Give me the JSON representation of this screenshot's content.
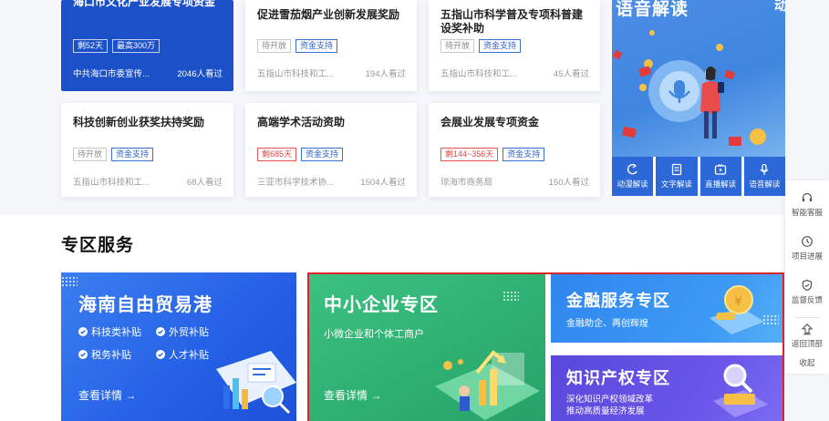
{
  "policy_cards": [
    {
      "title": "海口市文化产业发展专项资金",
      "tags": [
        {
          "text": "剩52天",
          "style": "white"
        },
        {
          "text": "最高300万",
          "style": "white"
        }
      ],
      "source": "中共海口市委宣传...",
      "views": "2046人看过",
      "highlighted": true
    },
    {
      "title": "促进雪茄烟产业创新发展奖励",
      "tags": [
        {
          "text": "待开放",
          "style": "gray"
        },
        {
          "text": "资金支持",
          "style": "blue"
        }
      ],
      "source": "五指山市科技和工...",
      "views": "194人看过"
    },
    {
      "title": "五指山市科学普及专项科普建设奖补助",
      "tags": [
        {
          "text": "待开放",
          "style": "gray"
        },
        {
          "text": "资金支持",
          "style": "blue"
        }
      ],
      "source": "五指山市科技和工...",
      "views": "45人看过"
    },
    {
      "title": "科技创新创业获奖扶持奖励",
      "tags": [
        {
          "text": "待开放",
          "style": "gray"
        },
        {
          "text": "资金支持",
          "style": "blue"
        }
      ],
      "source": "五指山市科技和工...",
      "views": "68人看过"
    },
    {
      "title": "高端学术活动资助",
      "tags": [
        {
          "text": "剩685天",
          "style": "red"
        },
        {
          "text": "资金支持",
          "style": "blue"
        }
      ],
      "source": "三亚市科学技术协...",
      "views": "1504人看过"
    },
    {
      "title": "会展业发展专项资金",
      "tags": [
        {
          "text": "剩144~356天",
          "style": "red"
        },
        {
          "text": "资金支持",
          "style": "blue"
        }
      ],
      "source": "琼海市商务局",
      "views": "150人看过"
    }
  ],
  "voice_panel": {
    "title": "语音解读",
    "title_partial": "动",
    "items": [
      {
        "label": "动漫解读",
        "icon": "animation-icon"
      },
      {
        "label": "文字解读",
        "icon": "document-icon"
      },
      {
        "label": "直播解读",
        "icon": "live-tv-icon"
      },
      {
        "label": "语音解读",
        "icon": "microphone-icon"
      }
    ]
  },
  "side_rail": {
    "items": [
      {
        "label": "智能客服",
        "icon": "headset-icon"
      },
      {
        "label": "项目进展",
        "icon": "clock-icon"
      },
      {
        "label": "监督反馈",
        "icon": "shield-icon"
      },
      {
        "label": "返回顶部",
        "icon": "arrow-up-icon"
      }
    ],
    "collapse_label": "收起"
  },
  "special_zones": {
    "section_title": "专区服务",
    "hainan": {
      "title": "海南自由贸易港",
      "features": [
        "科技类补贴",
        "外贸补贴",
        "税务补贴",
        "人才补贴"
      ],
      "link": "查看详情 →"
    },
    "sme": {
      "title": "中小企业专区",
      "subtitle": "小微企业和个体工商户",
      "link": "查看详情 →"
    },
    "finance": {
      "title": "金融服务专区",
      "subtitle": "金融助企、再创辉煌"
    },
    "ip": {
      "title": "知识产权专区",
      "subtitle_line1": "深化知识产权领域改革",
      "subtitle_line2": "推动高质量经济发展"
    }
  },
  "colors": {
    "accent_blue": "#1b50c8",
    "tag_blue": "#2f62cc",
    "tag_red": "#e04444",
    "zone_green": "#33b477",
    "zone_purple": "#6b4fe0",
    "selection_red": "#d9262c"
  }
}
